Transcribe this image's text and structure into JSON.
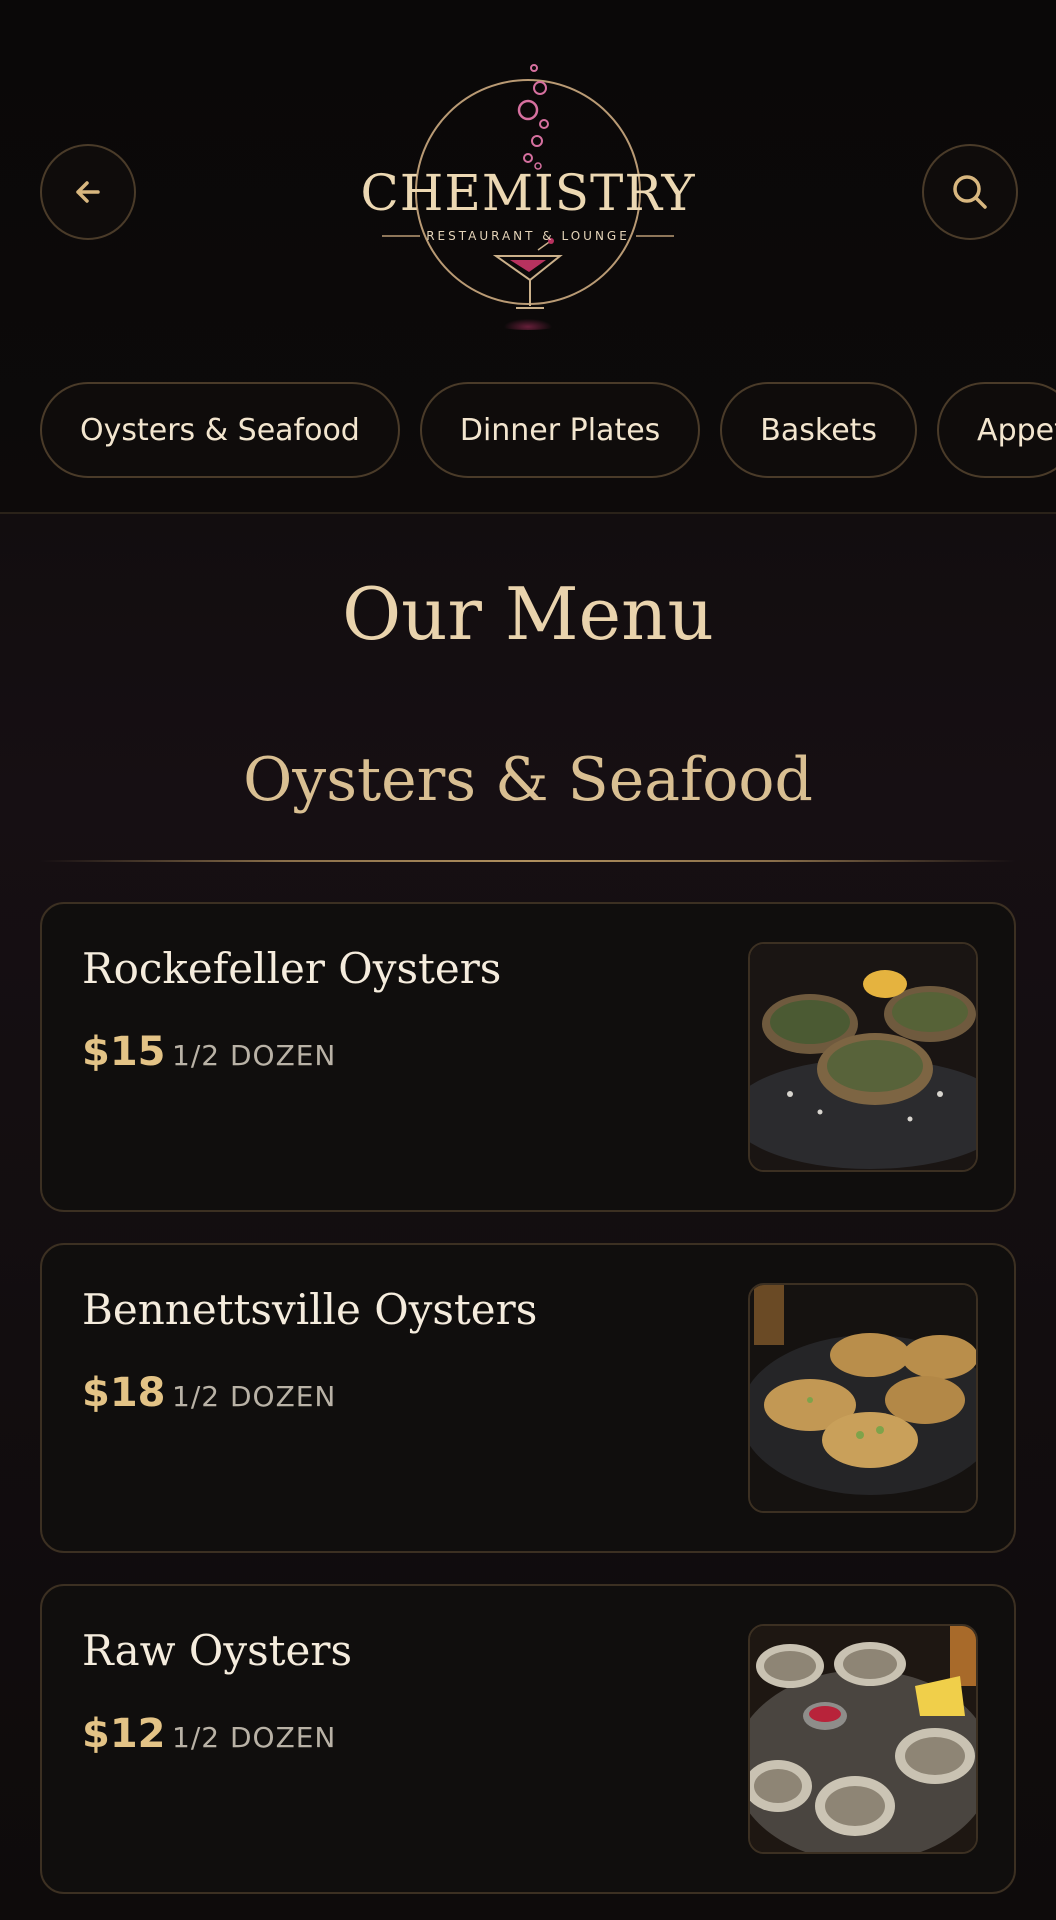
{
  "header": {
    "logo": {
      "name": "CHEMISTRY",
      "subtitle": "RESTAURANT & LOUNGE"
    },
    "back_icon": "arrow-left-icon",
    "search_icon": "search-icon"
  },
  "category_tabs": [
    {
      "label": "Oysters & Seafood"
    },
    {
      "label": "Dinner Plates"
    },
    {
      "label": "Baskets"
    },
    {
      "label": "Appet"
    }
  ],
  "main": {
    "title": "Our Menu",
    "section_title": "Oysters & Seafood",
    "items": [
      {
        "name": "Rockefeller Oysters",
        "price": "$15",
        "unit": "1/2 DOZEN"
      },
      {
        "name": "Bennettsville Oysters",
        "price": "$18",
        "unit": "1/2 DOZEN"
      },
      {
        "name": "Raw Oysters",
        "price": "$12",
        "unit": "1/2 DOZEN"
      }
    ]
  },
  "colors": {
    "accent_gold": "#e3c386",
    "title_gold": "#e9d3ad",
    "background": "#0b0909",
    "border": "#4a3b29"
  }
}
